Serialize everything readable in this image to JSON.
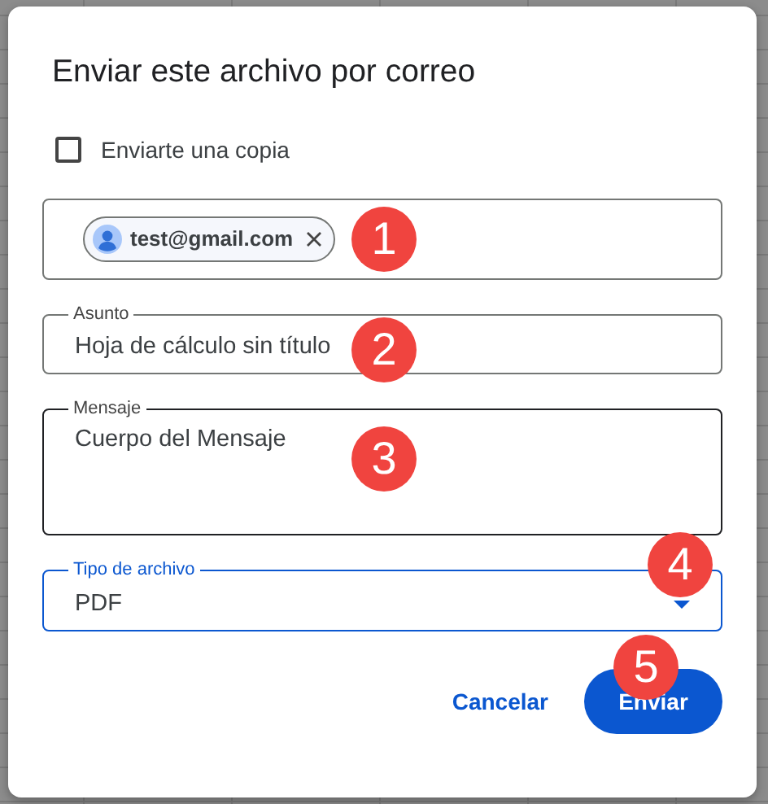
{
  "dialog": {
    "title": "Enviar este archivo por correo",
    "copy_checkbox": {
      "label": "Enviarte una copia",
      "checked": false
    },
    "recipients": [
      {
        "email": "test@gmail.com"
      }
    ],
    "fields": [
      {
        "kind": "text",
        "label": "Asunto",
        "value": "Hoja de cálculo sin título",
        "hovered": false,
        "focused": false
      },
      {
        "kind": "textarea",
        "label": "Mensaje",
        "value": "Cuerpo del Mensaje",
        "hovered": true,
        "focused": false
      },
      {
        "kind": "select",
        "label": "Tipo de archivo",
        "value": "PDF",
        "hovered": false,
        "focused": true
      }
    ],
    "buttons": [
      {
        "label": "Cancelar",
        "kind": "text"
      },
      {
        "label": "Enviar",
        "kind": "primary"
      }
    ]
  },
  "annotations": [
    {
      "label": "1"
    },
    {
      "label": "2"
    },
    {
      "label": "3"
    },
    {
      "label": "4"
    },
    {
      "label": "5"
    }
  ]
}
